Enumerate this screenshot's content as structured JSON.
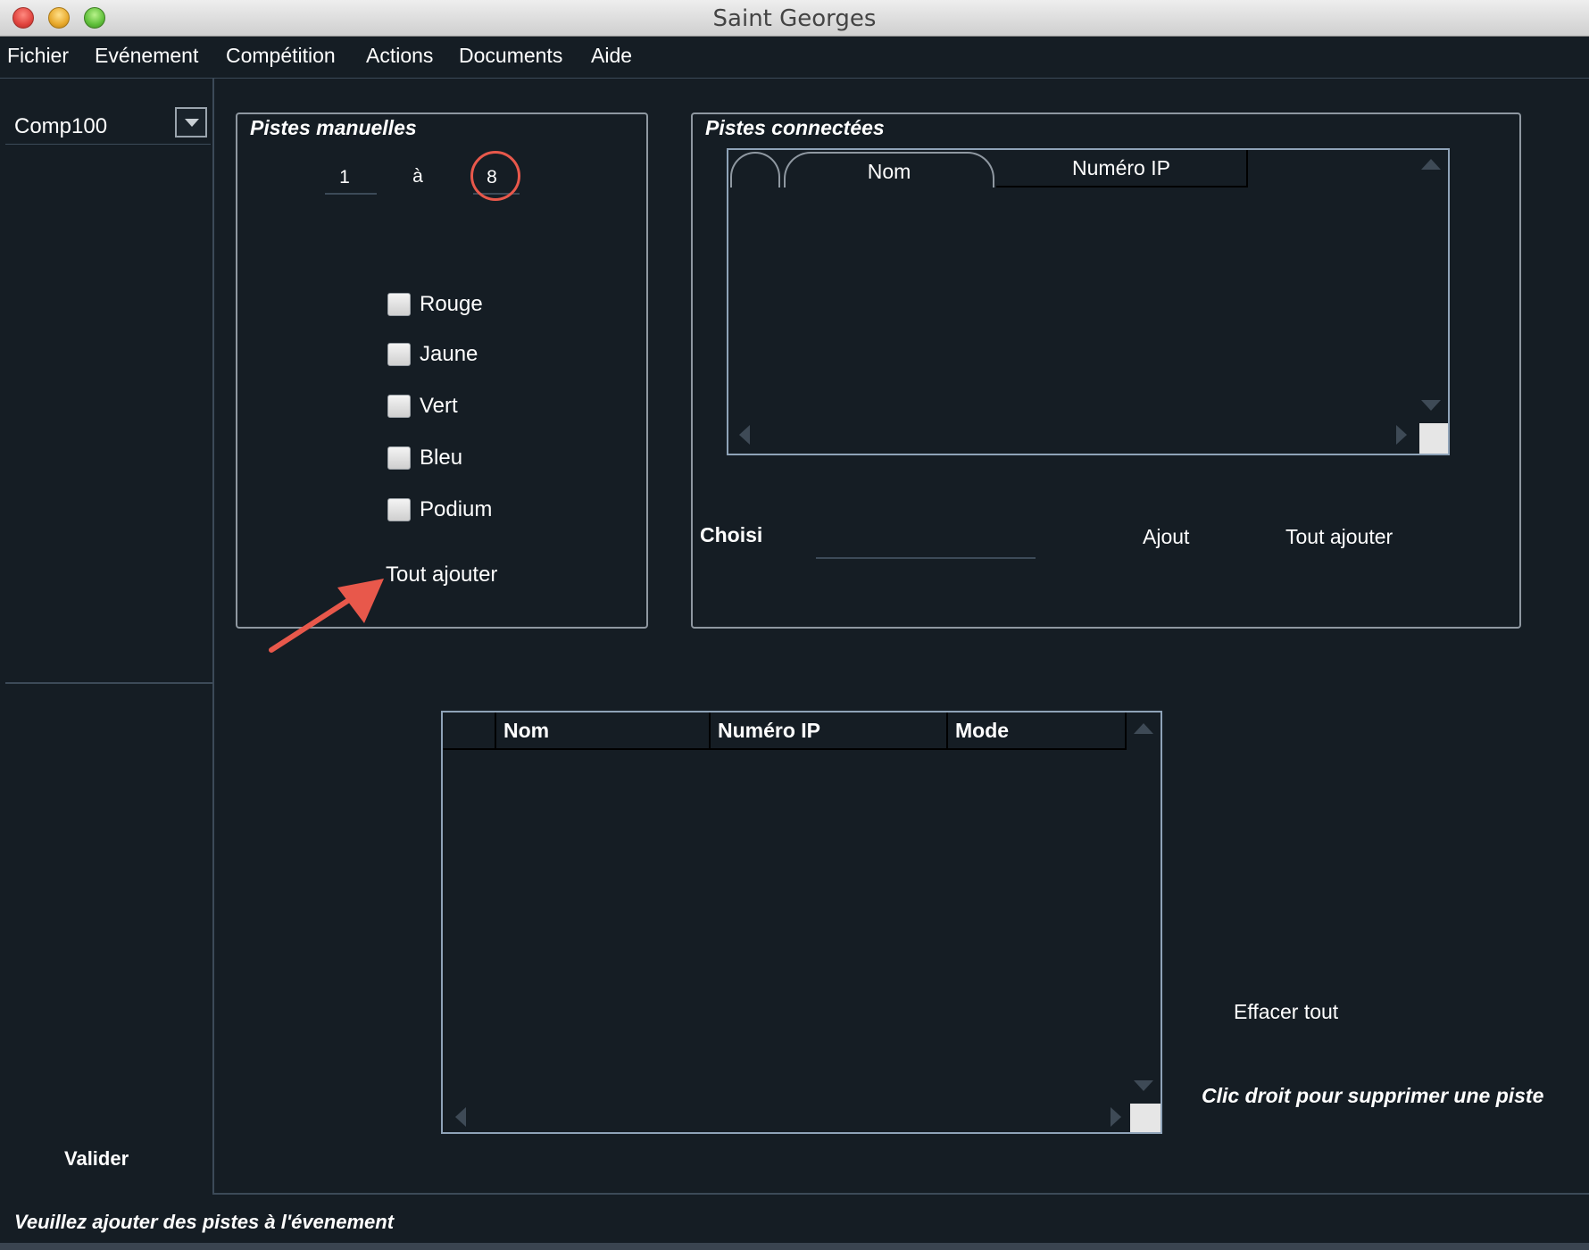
{
  "window": {
    "title": "Saint Georges"
  },
  "menu": [
    "Fichier",
    "Evénement",
    "Compétition",
    "Actions",
    "Documents",
    "Aide"
  ],
  "sidebar": {
    "competition_value": "Comp100",
    "validate_label": "Valider"
  },
  "manual_tracks": {
    "title": "Pistes manuelles",
    "from_value": "1",
    "to_label": "à",
    "to_value": "8",
    "checkboxes": [
      "Rouge",
      "Jaune",
      "Vert",
      "Bleu",
      "Podium"
    ],
    "add_all_label": "Tout ajouter"
  },
  "connected_tracks": {
    "title": "Pistes connectées",
    "columns": [
      "Nom",
      "Numéro IP"
    ],
    "chosen_label": "Choisi",
    "add_label": "Ajout",
    "add_all_label": "Tout ajouter"
  },
  "tracks_table": {
    "columns": [
      "Nom",
      "Numéro IP",
      "Mode"
    ]
  },
  "actions": {
    "clear_all_label": "Effacer tout",
    "right_click_hint": "Clic droit pour supprimer une piste"
  },
  "status_bar": {
    "message": "Veuillez ajouter des pistes à l'évenement"
  },
  "colors": {
    "background": "#151d24",
    "annotation": "#e8584b",
    "border": "#8f98a1"
  }
}
